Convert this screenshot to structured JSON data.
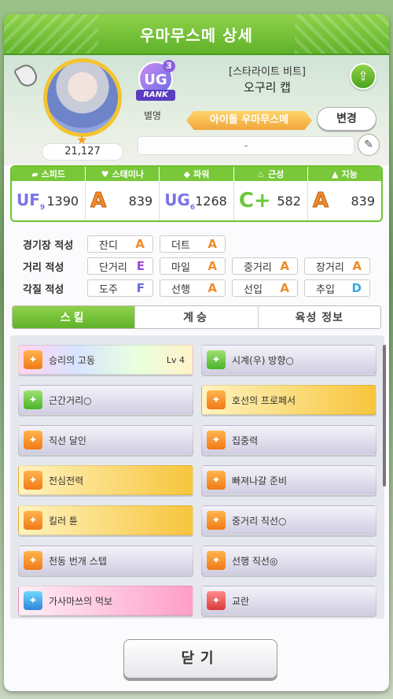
{
  "window": {
    "title": "우마무스메 상세"
  },
  "profile": {
    "fan_count": "21,127",
    "rank_label": "RANK",
    "rank_badge": "UG",
    "rank_sub": "3",
    "nickname_label": "별명",
    "title": "[스타라이트 비트]",
    "name": "오구리 캡",
    "nickname": "아이돌 우마무스메",
    "change_label": "변경",
    "comment": "-"
  },
  "stats": [
    {
      "label": "스피드",
      "grade": "UF",
      "grade_sub": "9",
      "value": "1390",
      "icon": "shoe-icon"
    },
    {
      "label": "스태미나",
      "grade": "A",
      "value": "839",
      "icon": "heart-icon"
    },
    {
      "label": "파워",
      "grade": "UG",
      "grade_sub": "6",
      "value": "1268",
      "icon": "muscle-icon"
    },
    {
      "label": "근성",
      "grade": "C+",
      "value": "582",
      "icon": "flame-icon"
    },
    {
      "label": "지능",
      "grade": "A",
      "value": "839",
      "icon": "graduation-cap-icon"
    }
  ],
  "aptitudes": {
    "track": {
      "label": "경기장 적성",
      "items": [
        {
          "name": "잔디",
          "grade": "A"
        },
        {
          "name": "더트",
          "grade": "A"
        }
      ]
    },
    "distance": {
      "label": "거리 적성",
      "items": [
        {
          "name": "단거리",
          "grade": "E"
        },
        {
          "name": "마일",
          "grade": "A"
        },
        {
          "name": "중거리",
          "grade": "A"
        },
        {
          "name": "장거리",
          "grade": "A"
        }
      ]
    },
    "style": {
      "label": "각질 적성",
      "items": [
        {
          "name": "도주",
          "grade": "F"
        },
        {
          "name": "선행",
          "grade": "A"
        },
        {
          "name": "선입",
          "grade": "A"
        },
        {
          "name": "추입",
          "grade": "D"
        }
      ]
    }
  },
  "tabs": [
    "스킬",
    "계승",
    "육성 정보"
  ],
  "skills": [
    {
      "name": "승리의 고동",
      "level": "Lv 4",
      "style": "rainbow",
      "icon": "orange"
    },
    {
      "name": "시계(우) 방향○",
      "style": "white",
      "icon": "green"
    },
    {
      "name": "근간거리○",
      "style": "white",
      "icon": "green"
    },
    {
      "name": "호선의 프로페서",
      "style": "gold",
      "icon": "orange"
    },
    {
      "name": "직선 달인",
      "style": "white",
      "icon": "orange"
    },
    {
      "name": "집중력",
      "style": "white",
      "icon": "orange"
    },
    {
      "name": "전심전력",
      "style": "gold",
      "icon": "orange"
    },
    {
      "name": "빠져나갈 준비",
      "style": "white",
      "icon": "orange"
    },
    {
      "name": "킬러 튠",
      "style": "gold",
      "icon": "orange"
    },
    {
      "name": "중거리 직선○",
      "style": "white",
      "icon": "orange"
    },
    {
      "name": "천동 번개 스텝",
      "style": "white",
      "icon": "orange"
    },
    {
      "name": "선행 직선◎",
      "style": "white",
      "icon": "orange"
    },
    {
      "name": "가사마쓰의 먹보",
      "style": "pink",
      "icon": "cyan"
    },
    {
      "name": "교란",
      "style": "white",
      "icon": "red"
    }
  ],
  "footer": {
    "close_label": "닫기"
  },
  "colors": {
    "accent": "#6cc22f",
    "grade_a": "#f08b2a",
    "grade_ug": "#7a73e6"
  }
}
